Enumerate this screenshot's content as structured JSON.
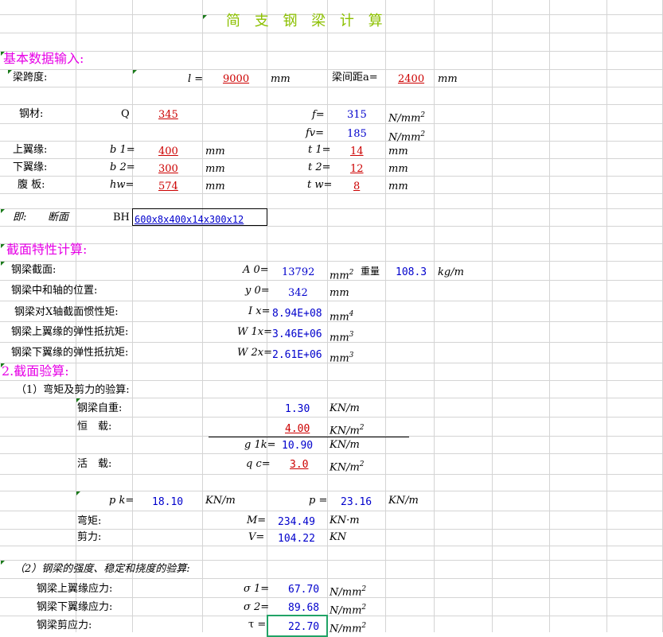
{
  "title": "简 支 钢 梁 计 算",
  "sections": {
    "basic_input": "基本数据输入:",
    "section_props": "截面特性计算:",
    "section_check": "2.截面验算:",
    "moment_shear": "（1）弯矩及剪力的验算:",
    "strength": "（2）钢梁的强度、稳定和挠度的验算:"
  },
  "input": {
    "span_label": "梁跨度:",
    "span_sym": "l =",
    "span_value": "9000",
    "span_unit": "mm",
    "spacing_label": "梁间距a=",
    "spacing_value": "2400",
    "spacing_unit": "mm",
    "steel_label": "钢材:",
    "steel_prefix": "Q",
    "steel_grade": "345",
    "f_sym": "f=",
    "f_value": "315",
    "f_unit": "N/mm",
    "f_exp": "2",
    "fv_sym": "fv=",
    "fv_value": "185",
    "fv_unit": "N/mm",
    "fv_exp": "2",
    "top_flange_label": "上翼缘:",
    "b1_sym": "b 1=",
    "b1_value": "400",
    "b1_unit": "mm",
    "t1_sym": "t 1=",
    "t1_value": "14",
    "t1_unit": "mm",
    "bot_flange_label": "下翼缘:",
    "b2_sym": "b 2=",
    "b2_value": "300",
    "b2_unit": "mm",
    "t2_sym": "t 2=",
    "t2_value": "12",
    "t2_unit": "mm",
    "web_label": "腹 板:",
    "hw_sym": "hw=",
    "hw_value": "574",
    "hw_unit": "mm",
    "tw_sym": "t w=",
    "tw_value": "8",
    "tw_unit": "mm",
    "ie_label": "即:",
    "section_label": "断面",
    "bh_label": "BH",
    "bh_value": "600x8x400x14x300x12"
  },
  "props": {
    "area_label": "钢梁截面:",
    "area_sym": "A 0=",
    "area_value": "13792",
    "area_unit": "mm",
    "area_exp": "2",
    "weight_label": "重量",
    "weight_value": "108.3",
    "weight_unit": "kg/m",
    "axis_label": "钢梁中和轴的位置:",
    "y0_sym": "y 0=",
    "y0_value": "342",
    "y0_unit": "mm",
    "inertia_label": "钢梁对X轴截面惯性矩:",
    "ix_sym": "I x=",
    "ix_value": "8.94E+08",
    "ix_unit": "mm",
    "ix_exp": "4",
    "w1_label": "钢梁上翼缘的弹性抵抗矩:",
    "w1_sym": "W 1x=",
    "w1_value": "3.46E+06",
    "w1_unit": "mm",
    "w1_exp": "3",
    "w2_label": "钢梁下翼缘的弹性抵抗矩:",
    "w2_sym": "W 2x=",
    "w2_value": "2.61E+06",
    "w2_unit": "mm",
    "w2_exp": "3"
  },
  "loads": {
    "self_label": "钢梁自重:",
    "self_value": "1.30",
    "self_unit": "KN/m",
    "dead_label": "恒　载:",
    "dead_value": "4.00",
    "dead_unit": "KN/m",
    "dead_exp": "2",
    "gk_sym": "g 1k=",
    "gk_value": "10.90",
    "gk_unit": "KN/m",
    "live_label": "活　载:",
    "qc_sym": "q c=",
    "qc_value": "3.0",
    "qc_unit": "KN/m",
    "qc_exp": "2",
    "pk_sym": "p k=",
    "pk_value": "18.10",
    "pk_unit": "KN/m",
    "p_sym": "p =",
    "p_value": "23.16",
    "p_unit": "KN/m",
    "moment_label": "弯矩:",
    "m_sym": "M=",
    "m_value": "234.49",
    "m_unit": "KN·m",
    "shear_label": "剪力:",
    "v_sym": "V=",
    "v_value": "104.22",
    "v_unit": "KN"
  },
  "stress": {
    "s1_label": "钢梁上翼缘应力:",
    "s1_sym": "σ 1=",
    "s1_value": "67.70",
    "s1_unit": "N/mm",
    "s1_exp": "2",
    "s2_label": "钢梁下翼缘应力:",
    "s2_sym": "σ 2=",
    "s2_value": "89.68",
    "s2_unit": "N/mm",
    "s2_exp": "2",
    "tau_label": "钢梁剪应力:",
    "tau_sym": "τ =",
    "tau_value": "22.70",
    "tau_unit": "N/mm",
    "tau_exp": "2"
  }
}
